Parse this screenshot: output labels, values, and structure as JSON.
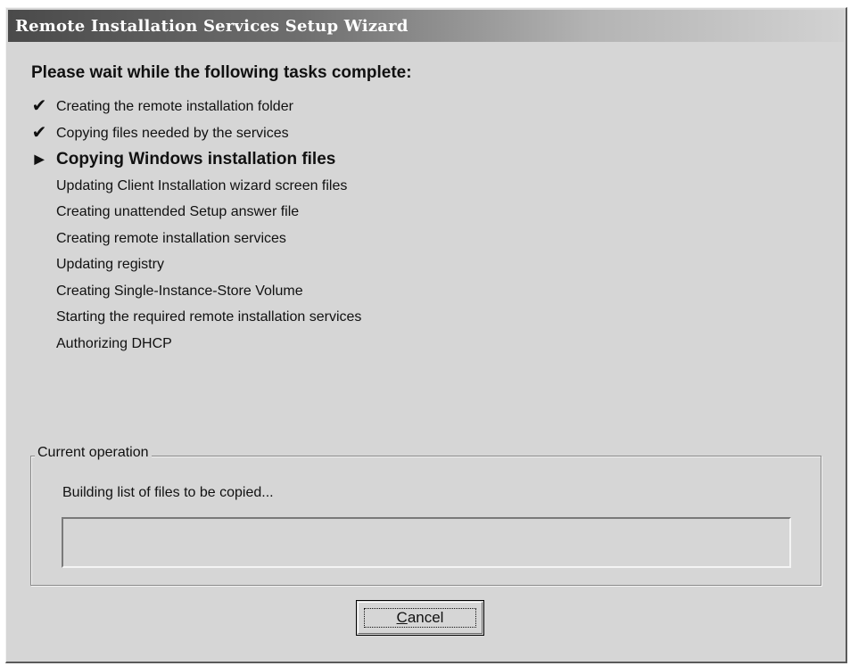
{
  "window": {
    "title": "Remote Installation Services Setup Wizard"
  },
  "heading": "Please wait while the following tasks complete:",
  "tasks": [
    {
      "label": "Creating the remote installation folder",
      "state": "done",
      "mark": "✔"
    },
    {
      "label": "Copying files needed by the services",
      "state": "done",
      "mark": "✔"
    },
    {
      "label": "Copying Windows installation files",
      "state": "current",
      "mark": "▶"
    },
    {
      "label": "Updating Client Installation wizard screen files",
      "state": "pending",
      "mark": ""
    },
    {
      "label": "Creating unattended Setup answer file",
      "state": "pending",
      "mark": ""
    },
    {
      "label": "Creating remote installation services",
      "state": "pending",
      "mark": ""
    },
    {
      "label": "Updating registry",
      "state": "pending",
      "mark": ""
    },
    {
      "label": "Creating Single-Instance-Store Volume",
      "state": "pending",
      "mark": ""
    },
    {
      "label": "Starting the required remote installation services",
      "state": "pending",
      "mark": ""
    },
    {
      "label": "Authorizing DHCP",
      "state": "pending",
      "mark": ""
    }
  ],
  "current_operation": {
    "group_label": "Current operation",
    "status_text": "Building list of files to be copied...",
    "progress": 0
  },
  "buttons": {
    "cancel_accel": "C",
    "cancel_rest": "ancel"
  },
  "colors": {
    "dialog_face": "#d6d6d6",
    "title_text": "#ffffff",
    "title_gradient_start": "#4a4a4a",
    "title_gradient_end": "#d2d2d2"
  }
}
